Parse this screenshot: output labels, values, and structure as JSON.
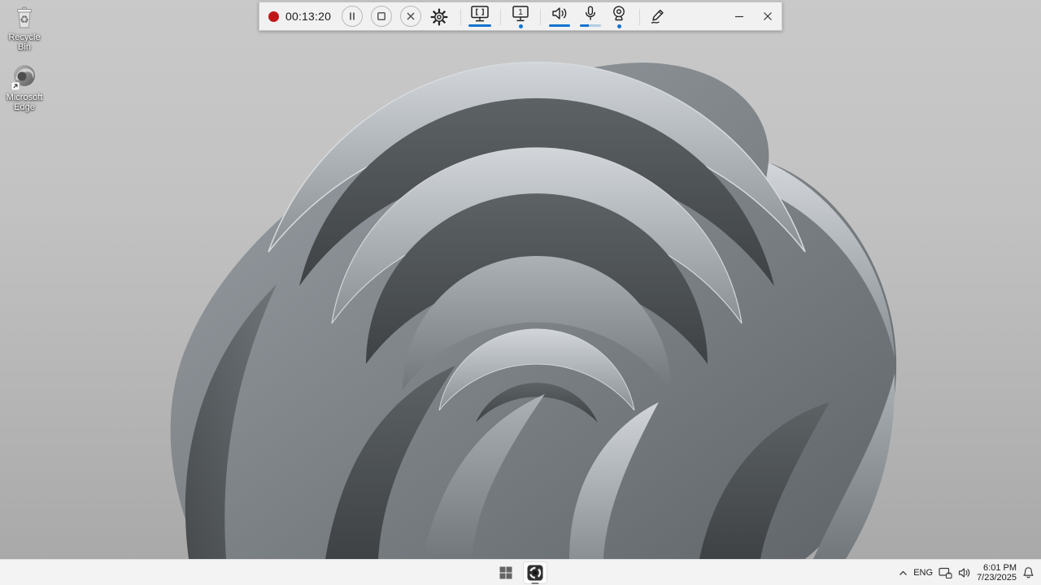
{
  "desktop_icons": [
    {
      "name": "recycle-bin",
      "label": "Recycle Bin"
    },
    {
      "name": "microsoft-edge",
      "label": "Microsoft Edge"
    }
  ],
  "recorder_toolbar": {
    "recording_indicator_icon": "record-dot",
    "timer": "00:13:20",
    "controls": [
      {
        "name": "pause-button",
        "icon": "pause-icon"
      },
      {
        "name": "stop-button",
        "icon": "stop-icon"
      },
      {
        "name": "cancel-button",
        "icon": "close-icon"
      },
      {
        "name": "settings-button",
        "icon": "gear-icon"
      }
    ],
    "sources": [
      {
        "name": "screen-capture",
        "icon": "monitor-select-icon",
        "state": "active-underline"
      },
      {
        "name": "display-1",
        "icon": "monitor-1-icon",
        "display_number": "1",
        "state": "active-dot"
      },
      {
        "name": "system-audio",
        "icon": "speaker-icon",
        "state": "active-underline"
      },
      {
        "name": "microphone",
        "icon": "microphone-icon",
        "state": "level-partial"
      },
      {
        "name": "webcam",
        "icon": "webcam-icon",
        "state": "active-dot"
      }
    ],
    "annotate_button": {
      "name": "pen-button",
      "icon": "pen-icon"
    },
    "window_buttons": [
      {
        "name": "minimize-button",
        "icon": "minimize-icon"
      },
      {
        "name": "close-button",
        "icon": "close-icon"
      }
    ],
    "colors": {
      "accent": "#1374cf",
      "accent_soft": "#b3cde2",
      "record_red": "#c01818",
      "background": "#f1f1f1"
    }
  },
  "taskbar": {
    "start_button_icon": "windows-start-icon",
    "apps": [
      {
        "name": "screen-recorder-app",
        "icon": "recorder-app-icon",
        "running": true
      }
    ],
    "tray": {
      "chevron_icon": "chevron-up-icon",
      "language": "ENG",
      "network_icon": "network-ethernet-icon",
      "volume_icon": "speaker-icon",
      "time": "6:01 PM",
      "date": "7/23/2025",
      "bell_icon": "notification-bell-icon"
    }
  }
}
